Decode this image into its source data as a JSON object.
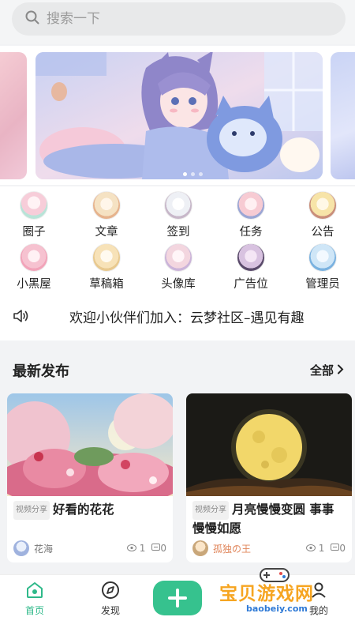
{
  "search": {
    "placeholder": "搜索一下"
  },
  "grid": [
    {
      "label": "圈子",
      "icon": "avatar-icon",
      "c1": "#f7cdd9",
      "c2": "#b8e4d8"
    },
    {
      "label": "文章",
      "icon": "avatar-icon",
      "c1": "#f5e2c3",
      "c2": "#e6b38d"
    },
    {
      "label": "签到",
      "icon": "avatar-icon",
      "c1": "#eef0f5",
      "c2": "#c7b7c9"
    },
    {
      "label": "任务",
      "icon": "avatar-icon",
      "c1": "#f7cbd3",
      "c2": "#9ba6d5"
    },
    {
      "label": "公告",
      "icon": "avatar-icon",
      "c1": "#f7e4a8",
      "c2": "#c98e7a"
    },
    {
      "label": "小黑屋",
      "icon": "avatar-icon",
      "c1": "#f6c2d0",
      "c2": "#f2a3b9"
    },
    {
      "label": "草稿箱",
      "icon": "avatar-icon",
      "c1": "#f7e2b8",
      "c2": "#e8c98f"
    },
    {
      "label": "头像库",
      "icon": "avatar-icon",
      "c1": "#f3d6df",
      "c2": "#cbb4d9"
    },
    {
      "label": "广告位",
      "icon": "avatar-icon",
      "c1": "#5a4a6b",
      "c2": "#d8c2e0"
    },
    {
      "label": "管理员",
      "icon": "avatar-icon",
      "c1": "#cfe6f7",
      "c2": "#7ab2e0"
    }
  ],
  "notice": {
    "text": "欢迎小伙伴们加入：云梦社区–遇见有趣"
  },
  "latest": {
    "title": "最新发布",
    "all": "全部",
    "posts": [
      {
        "tag": "视频分享",
        "title": "好看的花花",
        "author": "花海",
        "author_color": "#777777",
        "views": "1",
        "comments": "0"
      },
      {
        "tag": "视频分享",
        "title": "月亮慢慢变圆 事事慢慢如愿",
        "author": "孤独の王",
        "author_color": "#e0855a",
        "views": "1",
        "comments": "0"
      }
    ]
  },
  "nav": {
    "home": "首页",
    "discover": "发现",
    "mine": "我的"
  },
  "watermark": {
    "cn": "宝贝游戏网",
    "en": "baobeiy.com"
  },
  "colors": {
    "accent": "#36c28e"
  }
}
